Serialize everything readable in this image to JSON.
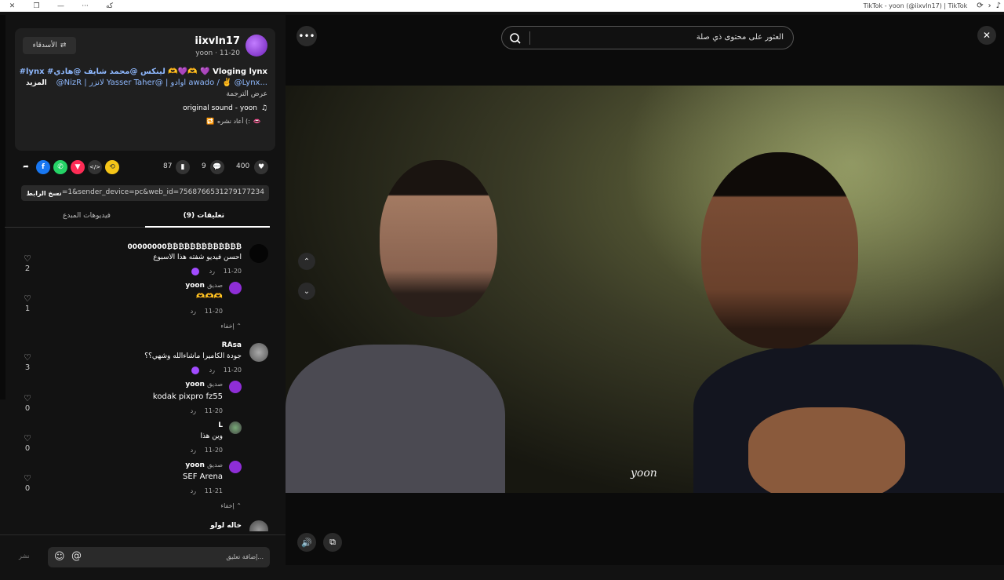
{
  "window": {
    "title": "TikTok - yoon (@iixvln17) | TikTok",
    "menu_icon": "ellipsis",
    "app_label": "كه"
  },
  "post": {
    "username": "iixvln17",
    "subline": "yoon · 11-20",
    "follow_label": "الأسدقاء",
    "desc_line1_prefix": "Vloging lynx",
    "desc_line1_tags": "#lynx #لينكس @محمد شايف @هادي",
    "desc_line2": "@NizR | لانزر Yasser Taher@ | اوادو awado / ✌️ @Lynx...",
    "more_label": "المزيد",
    "translate_label": "عرض الترجمة",
    "sound": "original sound - yoon",
    "reposted": "أعاد نشره (:"
  },
  "actions": {
    "likes": "400",
    "comments": "9",
    "saves": "87"
  },
  "link": {
    "url": "...=1&sender_device=pc&web_id=7568766531279177234",
    "copy_label": "نسخ الرابط"
  },
  "tabs": {
    "comments_label": "(9) تعليقات",
    "creator_videos_label": "فيديوهات المبدع"
  },
  "comments": [
    {
      "name": "00000000₿₿₿₿₿₿₿₿₿₿₿₿₿",
      "text": "احسن فيديو شفته هذا الاسبوع",
      "date": "11-20",
      "reply": "رد",
      "likes": "2"
    },
    {
      "name": "yoon",
      "badge": "صديق",
      "text": "🫶🫶🫶",
      "date": "11-20",
      "reply": "رد",
      "likes": "1"
    },
    {
      "name": "RAsa",
      "text": "جودة الكاميرا ماشاءالله وشهي؟؟",
      "date": "11-20",
      "reply": "رد",
      "likes": "3"
    },
    {
      "name": "yoon",
      "badge": "صديق",
      "text": "kodak pixpro fz55",
      "date": "11-20",
      "reply": "رد",
      "likes": "0"
    },
    {
      "name": "L",
      "text": "وين هذا",
      "date": "11-20",
      "reply": "رد",
      "likes": "0"
    },
    {
      "name": "yoon",
      "badge": "صديق",
      "text": "SEF Arena",
      "date": "11-21",
      "reply": "رد",
      "likes": "0"
    },
    {
      "name": "خاله لولو",
      "text": "",
      "date": "",
      "reply": "",
      "likes": ""
    }
  ],
  "hide_label": "إخفاء",
  "composer": {
    "placeholder": "إضافة تعليق...",
    "post_label": "نشر"
  },
  "video": {
    "search_placeholder": "العثور على محتوى ذي صلة",
    "watermark": "yoon"
  }
}
